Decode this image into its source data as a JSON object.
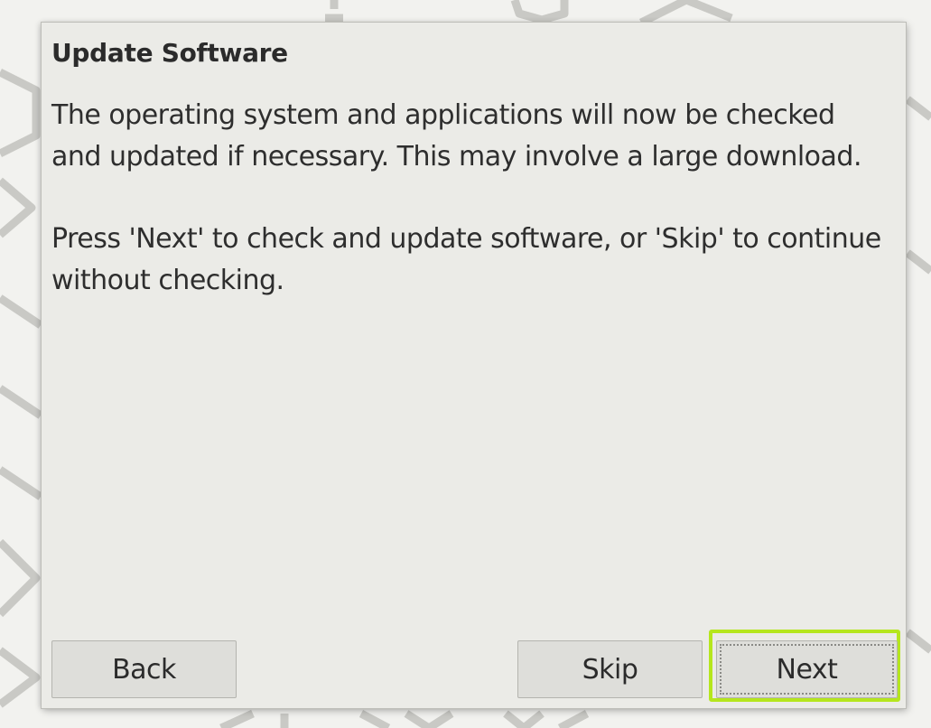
{
  "dialog": {
    "title": "Update Software",
    "paragraphs": [
      "The operating system and applications will now be checked and updated if necessary. This may involve a large download.",
      "Press 'Next' to check and update software, or 'Skip' to continue without checking."
    ]
  },
  "buttons": {
    "back_label": "Back",
    "skip_label": "Skip",
    "next_label": "Next"
  },
  "colors": {
    "dialog_bg": "#ebebe7",
    "button_bg": "#dededa",
    "highlight": "#b5e61d",
    "text": "#2b2b2b"
  },
  "state": {
    "focused_button": "next",
    "highlighted_button": "next"
  }
}
